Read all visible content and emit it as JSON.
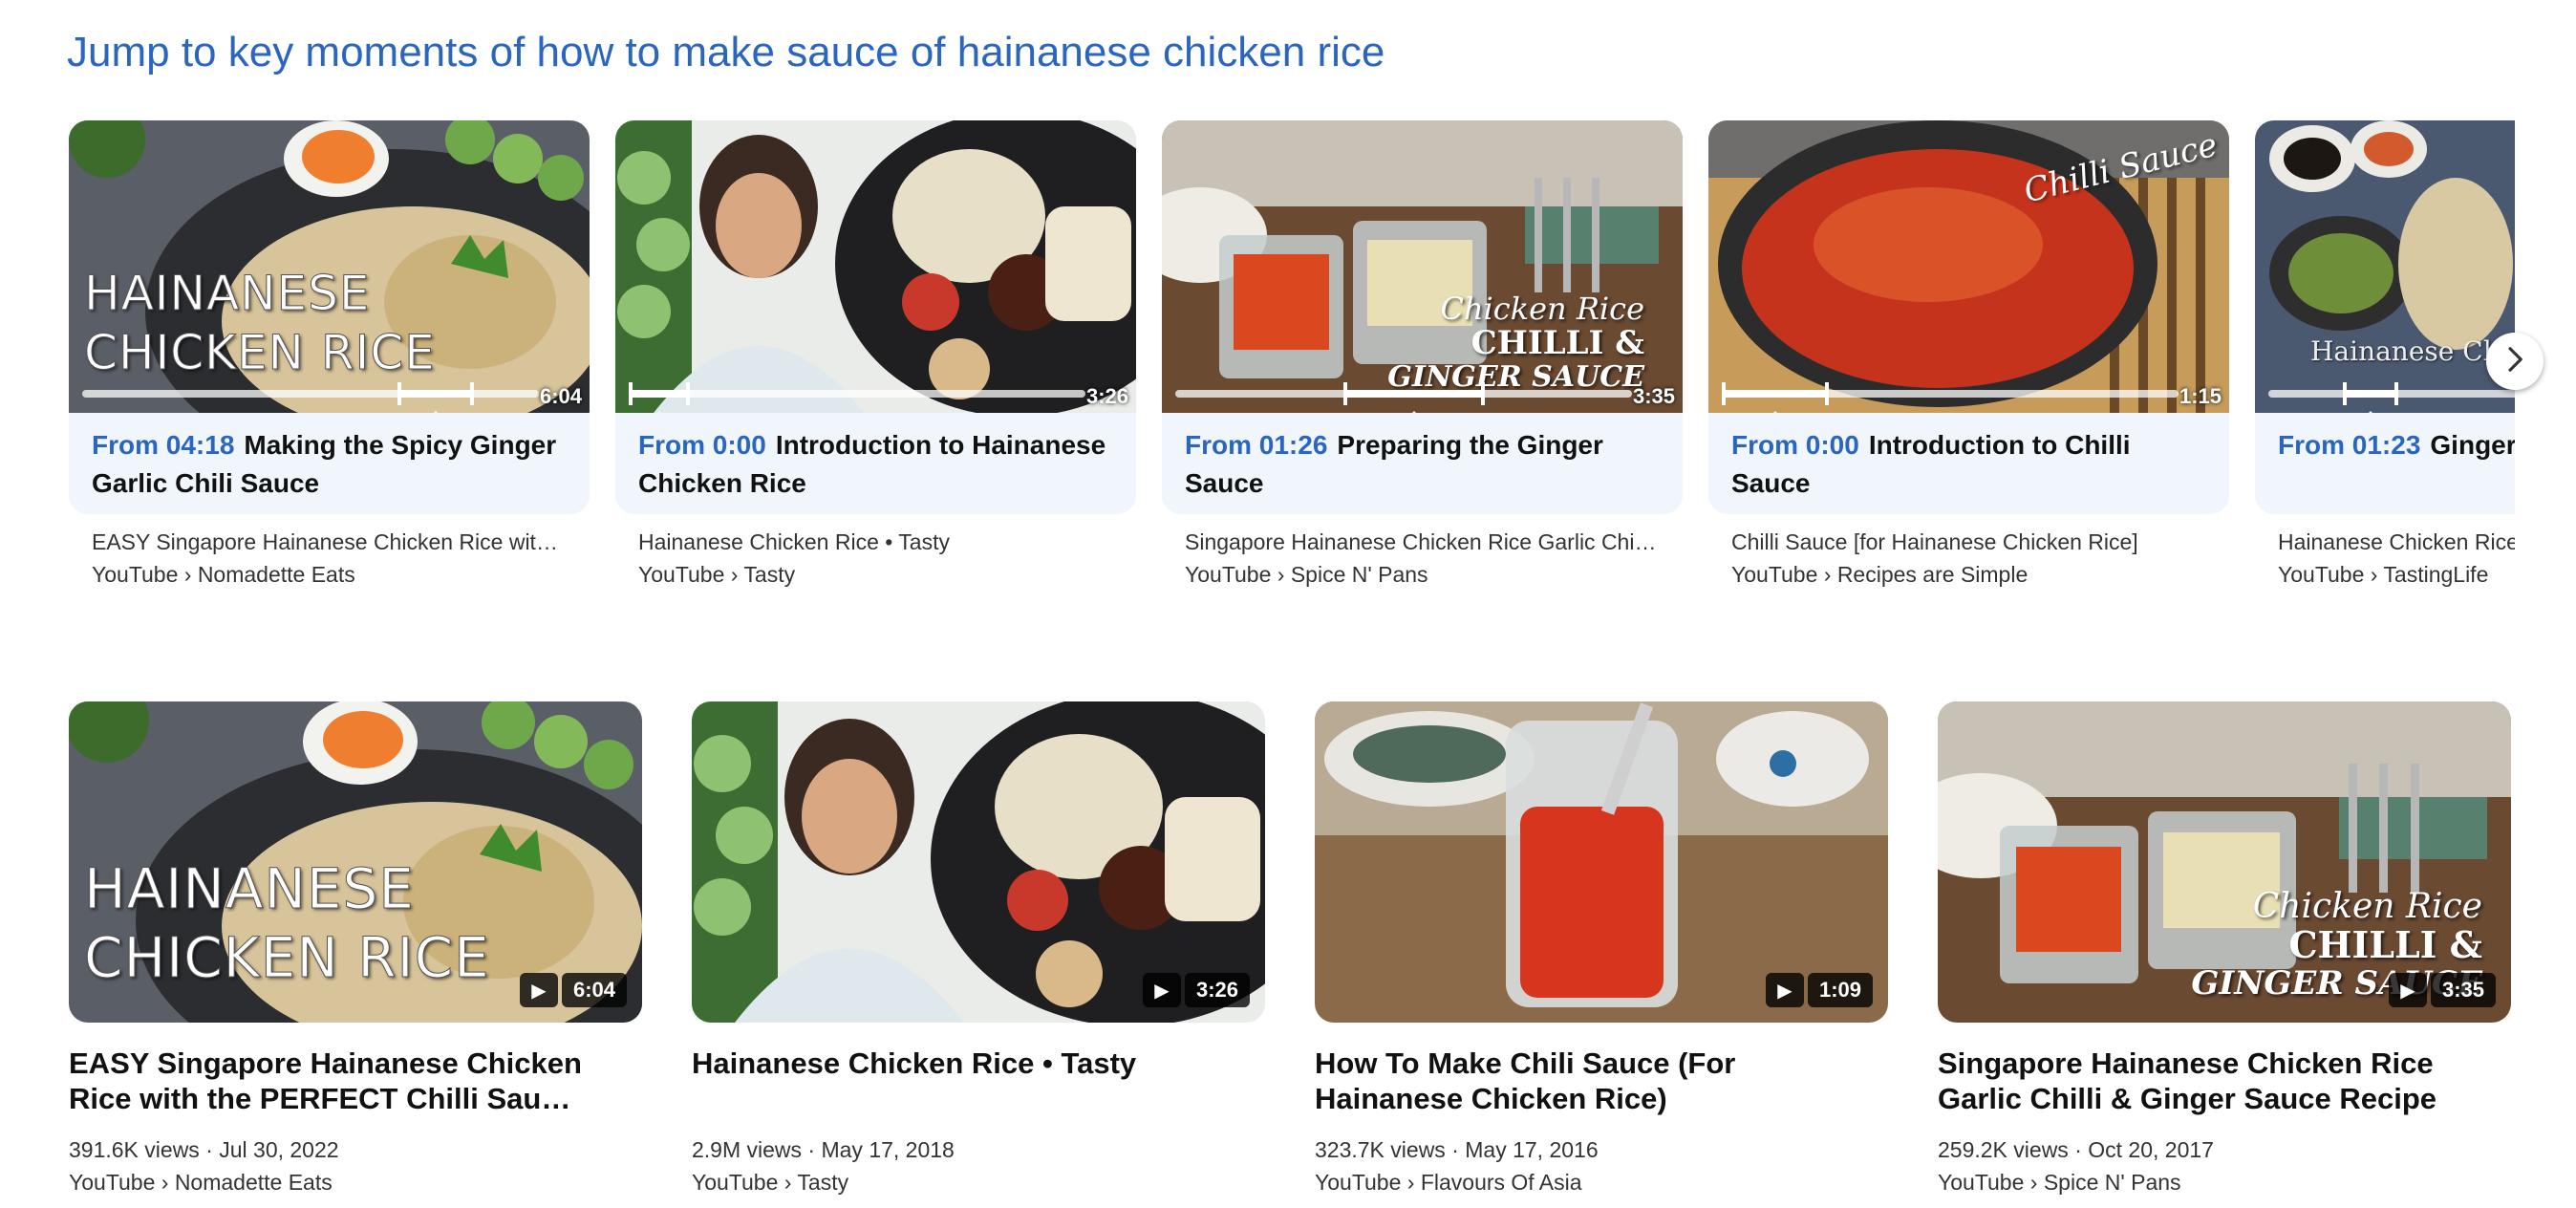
{
  "heading": "Jump to key moments of how to make sauce of hainanese chicken rice",
  "key_moments": [
    {
      "thumb_text": [
        "HAINANESE",
        "CHICKEN RICE"
      ],
      "duration": "6:04",
      "progress": {
        "start": 0.69,
        "end": 0.85
      },
      "from": "From 04:18",
      "moment": "Making the Spicy Ginger Garlic Chili Sauce",
      "video_title": "EASY Singapore Hainanese Chicken Rice with …",
      "source": "YouTube › Nomadette Eats"
    },
    {
      "thumb_text": [],
      "duration": "3:26",
      "progress": {
        "start": 0.0,
        "end": 0.12
      },
      "from": "From 0:00",
      "moment": "Introduction to Hainanese Chicken Rice",
      "video_title": "Hainanese Chicken Rice • Tasty",
      "source": "YouTube › Tasty"
    },
    {
      "thumb_text": [
        "Chicken Rice",
        "CHILLI &",
        "GINGER SAUCE"
      ],
      "duration": "3:35",
      "progress": {
        "start": 0.37,
        "end": 0.66
      },
      "from": "From 01:26",
      "moment": "Preparing the Ginger Sauce",
      "video_title": "Singapore Hainanese Chicken Rice Garlic Chilli …",
      "source": "YouTube › Spice N' Pans"
    },
    {
      "thumb_text": [
        "Chilli Sauce"
      ],
      "duration": "1:15",
      "progress": {
        "start": 0.0,
        "end": 0.22
      },
      "from": "From 0:00",
      "moment": "Introduction to Chilli Sauce",
      "video_title": "Chilli Sauce [for Hainanese Chicken Rice]",
      "source": "YouTube › Recipes are Simple"
    },
    {
      "thumb_text": [
        "Hainanese Chic"
      ],
      "duration": "",
      "progress": {
        "start": 0.35,
        "end": 0.55
      },
      "from": "From 01:23",
      "moment": "Ginger a Sauce",
      "video_title": "Hainanese Chicken Rice",
      "source": "YouTube › TastingLife"
    }
  ],
  "next_icon": "chevron-right-icon",
  "videos": [
    {
      "thumb_text": [
        "HAINANESE",
        "CHICKEN RICE"
      ],
      "duration": "6:04",
      "title": "EASY Singapore Hainanese Chicken Rice with the PERFECT Chilli Sau…",
      "views_date": "391.6K views · Jul 30, 2022",
      "source": "YouTube › Nomadette Eats"
    },
    {
      "thumb_text": [],
      "duration": "3:26",
      "title": "Hainanese Chicken Rice • Tasty",
      "views_date": "2.9M views · May 17, 2018",
      "source": "YouTube › Tasty"
    },
    {
      "thumb_text": [],
      "duration": "1:09",
      "title": "How To Make Chili Sauce (For Hainanese Chicken Rice)",
      "views_date": "323.7K views · May 17, 2016",
      "source": "YouTube › Flavours Of Asia"
    },
    {
      "thumb_text": [
        "Chicken Rice",
        "CHILLI &",
        "GINGER SAUCE"
      ],
      "duration": "3:35",
      "title": "Singapore Hainanese Chicken Rice Garlic Chilli & Ginger Sauce Recipe",
      "views_date": "259.2K views · Oct 20, 2017",
      "source": "YouTube › Spice N' Pans"
    }
  ],
  "play_icon": "play-icon"
}
